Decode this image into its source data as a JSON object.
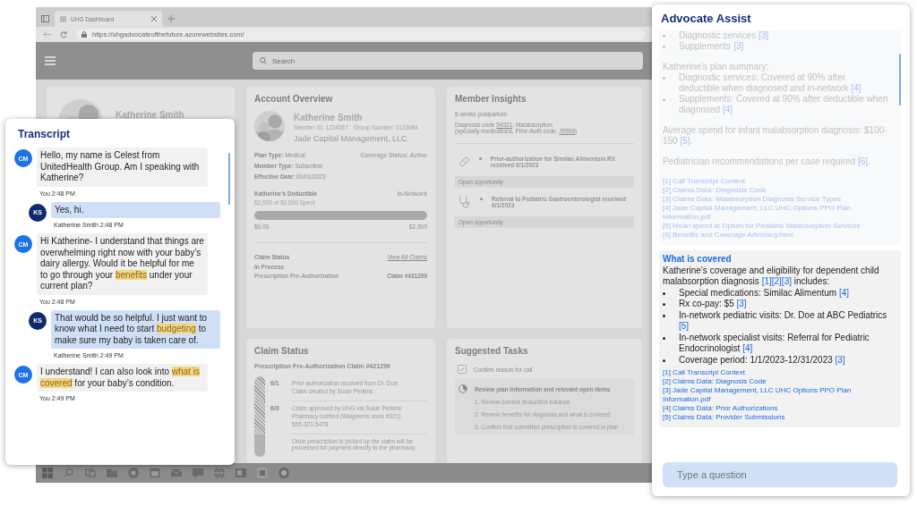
{
  "browser": {
    "tab_title": "UHG Dashboard",
    "url": "https://uhgadvocateofthefuture.azurewebsites.com/"
  },
  "app_header": {
    "search_placeholder": "Search"
  },
  "profile_card": {
    "name": "Katherine Smith"
  },
  "account_overview": {
    "title": "Account Overview",
    "name": "Katherine Smith",
    "member_id": "Member ID: 1234567",
    "group_number": "Group Number: 0123984",
    "employer": "Jade Capital Management, LLC",
    "fields": [
      {
        "label": "Plan Type:",
        "value": "Medical"
      },
      {
        "label": "Member Type:",
        "value": "Subscriber"
      },
      {
        "label": "Effective Date:",
        "value": "01/01/2023"
      }
    ],
    "coverage_status": "Coverage Status: Active",
    "deductible": {
      "title": "Katherine’s Deductible",
      "network": "In-Network",
      "spent": "$2,500 of $2,500 Spent",
      "level": 1,
      "min": "$0.00",
      "max": "$2,500"
    },
    "claim": {
      "title": "Claim Status",
      "link": "View All Claims",
      "status": "In Process",
      "name": "Prescription Pre-Authorization",
      "number": "Claim #431299"
    }
  },
  "member_insights": {
    "title": "Member Insights",
    "note": "8 weeks postpartum",
    "diagnosis_lines": [
      [
        {
          "text": "Diagnosis code "
        },
        {
          "link": "54321"
        },
        {
          "text": ": Malabsorption"
        }
      ],
      [
        {
          "text": "(specialty medications, Prior-Auth code: "
        },
        {
          "link": "J5555"
        },
        {
          "text": ")"
        }
      ]
    ],
    "insights": [
      {
        "kind": "pill",
        "text": "Prior-authorization for Similac Alimentum RX received 6/1/2023",
        "action": "Open opportunity"
      },
      {
        "kind": "stethoscope",
        "text": "Referral to Pediatric Gastroenterologist received 6/1/2023",
        "action": "Open opportunity"
      }
    ]
  },
  "claim_status": {
    "title": "Claim Status",
    "claim_title": "Prescription Pre-Authorization Claim #421299",
    "steps": [
      {
        "date": "6/1",
        "done": true,
        "lines": [
          "Prior authorization received from Dr. Doe",
          "Claim created by Susie Perkins"
        ]
      },
      {
        "date": "6/3",
        "done": true,
        "lines": [
          "Claim approved by UHG via Susie Perkins",
          "Pharmacy notified (Walgreens store #321)",
          "555-321-5478"
        ]
      },
      {
        "done": false,
        "lines": [
          "Once prescription is picked up the claim will be processed for payment directly to the pharmacy."
        ]
      }
    ]
  },
  "suggested_tasks": {
    "title": "Suggested Tasks",
    "tasks": [
      {
        "kind": "checkbox",
        "text": "Confirm reason for call",
        "checked": true
      },
      {
        "kind": "progress",
        "text": "Review plan information and relevant open items",
        "steps": [
          "1. Review current deductible balance",
          "2. Review benefits for diagnosis and what is covered",
          "3. Confirm that submitted prescription is covered in plan"
        ]
      }
    ]
  },
  "transcript": {
    "title": "Transcript",
    "messages": [
      {
        "kind": "agent",
        "initials": "CM",
        "parts": [
          {
            "text": "Hello, my name is Celest from UnitedHealth Group. Am I speaking with Katherine?"
          }
        ],
        "meta": "You 2:48 PM"
      },
      {
        "kind": "member",
        "initials": "KS",
        "parts": [
          {
            "text": "Yes, hi."
          }
        ],
        "meta": "Katherine Smith 2:48 PM"
      },
      {
        "kind": "agent",
        "initials": "CM",
        "parts": [
          {
            "text": "Hi Katherine- I understand that things are overwhelming right now with your baby’s dairy allergy. Would it be helpful for me to go through your "
          },
          {
            "highlight": "benefits"
          },
          {
            "text": " under your current plan?"
          }
        ],
        "meta": "You 2:48 PM"
      },
      {
        "kind": "member",
        "initials": "KS",
        "parts": [
          {
            "text": "That would be so helpful. I just want to know what I need to start "
          },
          {
            "highlight": "budgeting"
          },
          {
            "text": " to make sure my baby is taken care of."
          }
        ],
        "meta": "Katherine Smith 2:49 PM"
      },
      {
        "kind": "agent",
        "initials": "CM",
        "parts": [
          {
            "text": "I understand! I can also look into "
          },
          {
            "highlight": "what is covered"
          },
          {
            "text": " for your baby’s condition."
          }
        ],
        "meta": "You 2:49 PM"
      }
    ]
  },
  "advocate_assist": {
    "title": "Advocate Assist",
    "history": {
      "sections": [
        {
          "items": [
            {
              "kind": "bullet",
              "parts": [
                {
                  "text": "Diagnostic services "
                },
                {
                  "ref": "[3]"
                }
              ]
            },
            {
              "kind": "bullet",
              "parts": [
                {
                  "text": "Supplements "
                },
                {
                  "ref": "[3]"
                }
              ]
            }
          ]
        },
        {
          "items": [
            {
              "kind": "para",
              "parts": [
                {
                  "text": "Katherine’s plan summary:"
                }
              ]
            },
            {
              "kind": "bullet",
              "parts": [
                {
                  "text": "Diagnostic services: Covered at 90% after deductible when diagnosed and in-network "
                },
                {
                  "ref": "[4]"
                }
              ]
            },
            {
              "kind": "bullet",
              "parts": [
                {
                  "text": "Supplements: Covered at 90% after deductible when diagnosed "
                },
                {
                  "ref": "[4]"
                }
              ]
            }
          ]
        },
        {
          "items": [
            {
              "kind": "para",
              "parts": [
                {
                  "text": "Average spend for infant malabsorption diagnosis: $100-150 "
                },
                {
                  "ref": "[5]"
                },
                {
                  "text": "."
                }
              ]
            }
          ]
        },
        {
          "items": [
            {
              "kind": "para",
              "parts": [
                {
                  "text": "Pediatrician recommendations per case required "
                },
                {
                  "ref": "[6]"
                },
                {
                  "text": "."
                }
              ]
            }
          ]
        }
      ],
      "sources": [
        "[1] Call Transcript Context",
        "[2] Claims Data: Diagnosis Code",
        "[3] Claims Data: Malabsorption Diagnosis Service Types",
        "[4] Jade Capital Management, LLC UHC Options PPO Plan Information.pdf",
        "[5] Mean spend at Optum for Pediatric Malabsorption Services",
        "[6] Benefits and Coverage Advocacy.html"
      ]
    },
    "answer": {
      "title": "What is covered",
      "intro": [
        {
          "text": "Katherine’s coverage and eligibility for dependent child malabsorption diagnosis "
        },
        {
          "ref": "[1][2][3]"
        },
        {
          "text": " includes:"
        }
      ],
      "bullets": [
        [
          {
            "text": "Special medications: Similac Alimentum "
          },
          {
            "ref": "[4]"
          }
        ],
        [
          {
            "text": "Rx co-pay: $5 "
          },
          {
            "ref": "[3]"
          }
        ],
        [
          {
            "text": "In-network pediatric visits: Dr. Doe at ABC Pediatrics "
          },
          {
            "ref": "[5]"
          }
        ],
        [
          {
            "text": "In-network specialist visits: Referral for Pediatric Endocrinologist "
          },
          {
            "ref": "[4]"
          }
        ],
        [
          {
            "text": "Coverage period: 1/1/2023-12/31/2023 "
          },
          {
            "ref": "[3]"
          }
        ]
      ],
      "sources": [
        "[1] Call Transcript Context",
        "[2] Claims Data: Diagnosis Code",
        "[3] Jade Capital Management, LLC UHC Options PPO Plan Information.pdf",
        "[4] Claims Data: Prior Authorizations",
        "[5] Claims Data: Provider Submissions"
      ]
    },
    "input_placeholder": "Type a question"
  }
}
